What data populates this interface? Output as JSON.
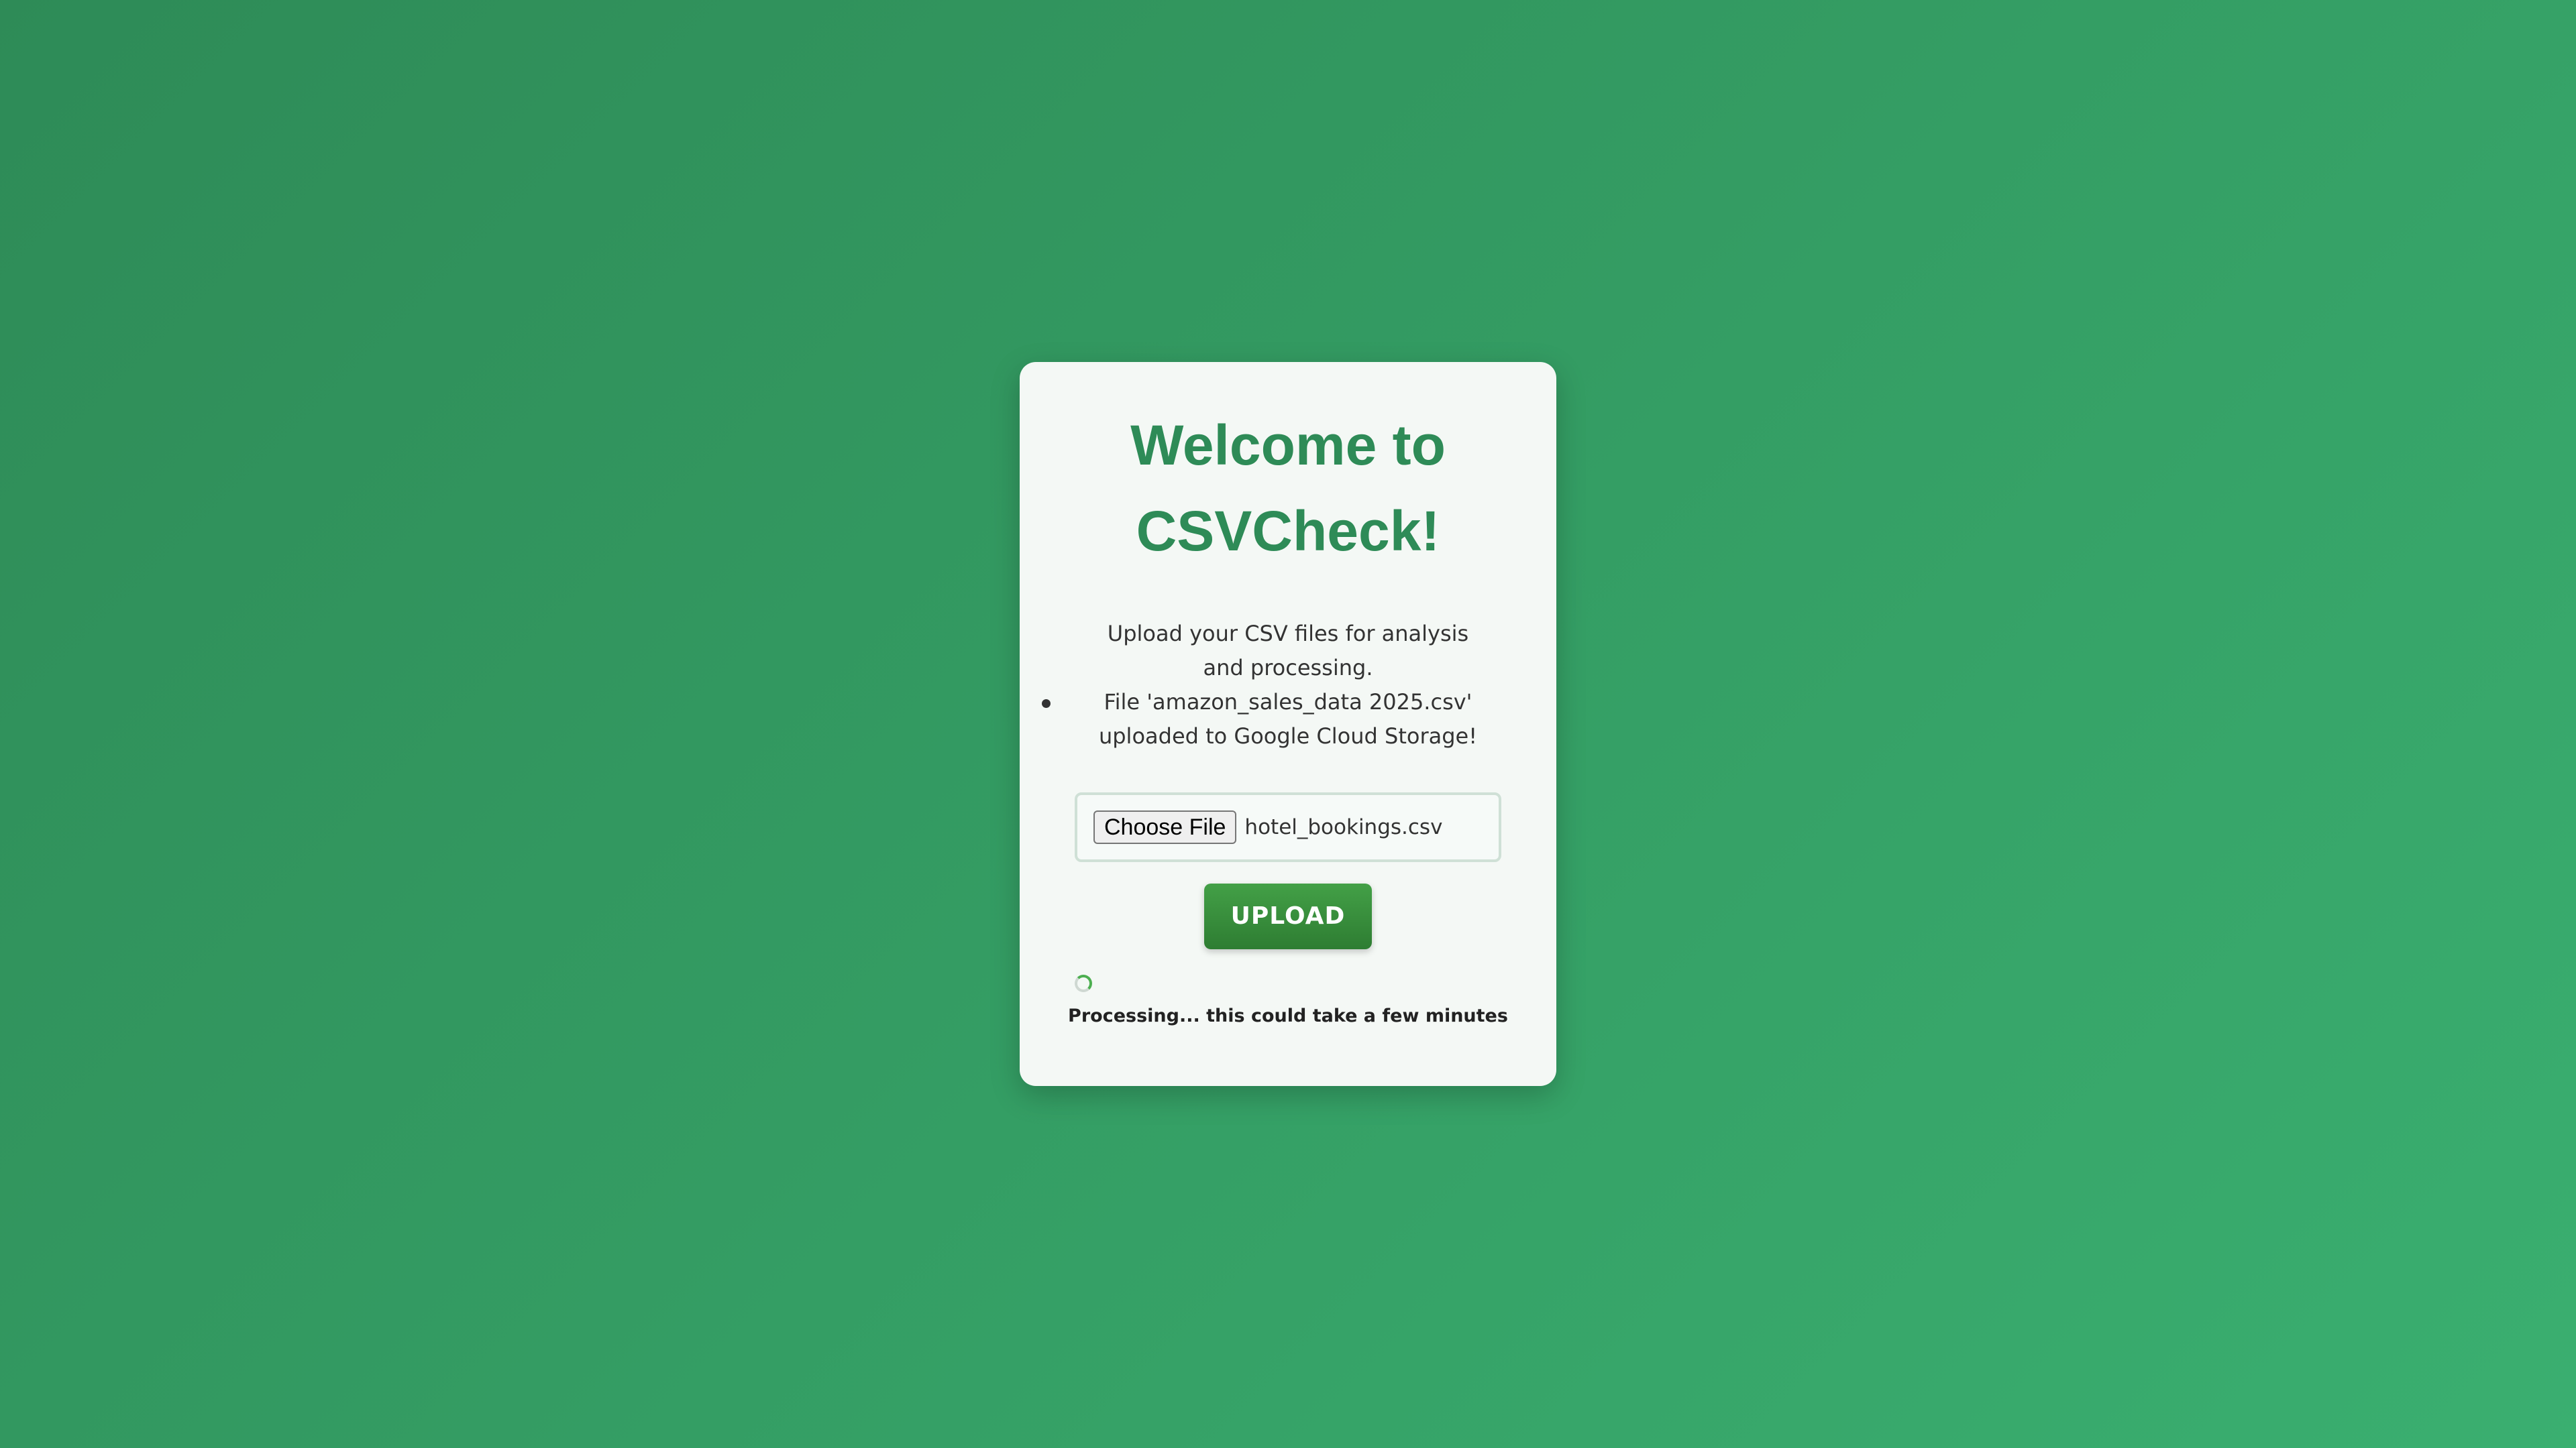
{
  "card": {
    "title_line1": "Welcome to",
    "title_line2": "CSVCheck!",
    "subtitle": "Upload your CSV files for analysis and processing.",
    "messages": [
      "File 'amazon_sales_data 2025.csv' uploaded to Google Cloud Storage!"
    ]
  },
  "file_input": {
    "button_label": "Choose File",
    "file_name": "hotel_bookings.csv"
  },
  "upload_button": {
    "label": "UPLOAD"
  },
  "status": {
    "text": "Processing... this could take a few minutes",
    "icon": "loading-spinner-icon"
  },
  "colors": {
    "background_gradient_start": "#2e8b57",
    "background_gradient_end": "#3aaf70",
    "title": "#2e8b57",
    "button": "#43a047"
  }
}
